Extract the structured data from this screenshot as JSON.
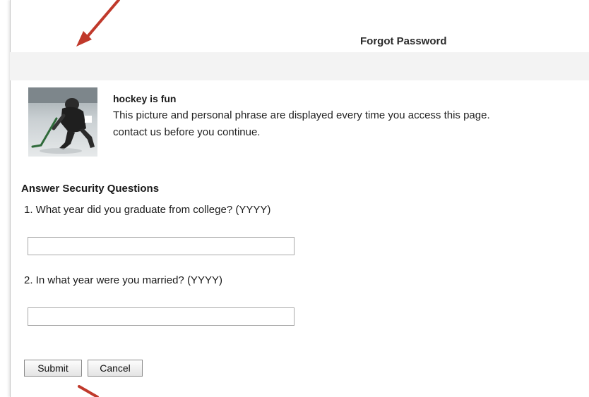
{
  "header": {
    "title": "Forgot Password"
  },
  "security_image": {
    "icon": "hockey-player-photo",
    "phrase": "hockey is fun",
    "description_line1": "This picture and personal phrase are displayed every time you access this page.",
    "description_line2": "contact us before you continue."
  },
  "security_questions": {
    "heading": "Answer Security Questions",
    "q1_label": "1. What year did you graduate from college? (YYYY)",
    "q1_value": "",
    "q2_label": "2. In what year were you married? (YYYY)",
    "q2_value": ""
  },
  "actions": {
    "submit_label": "Submit",
    "cancel_label": "Cancel"
  },
  "colors": {
    "annotation_arrow": "#c0392b",
    "title_bar": "#f3f3f3"
  }
}
